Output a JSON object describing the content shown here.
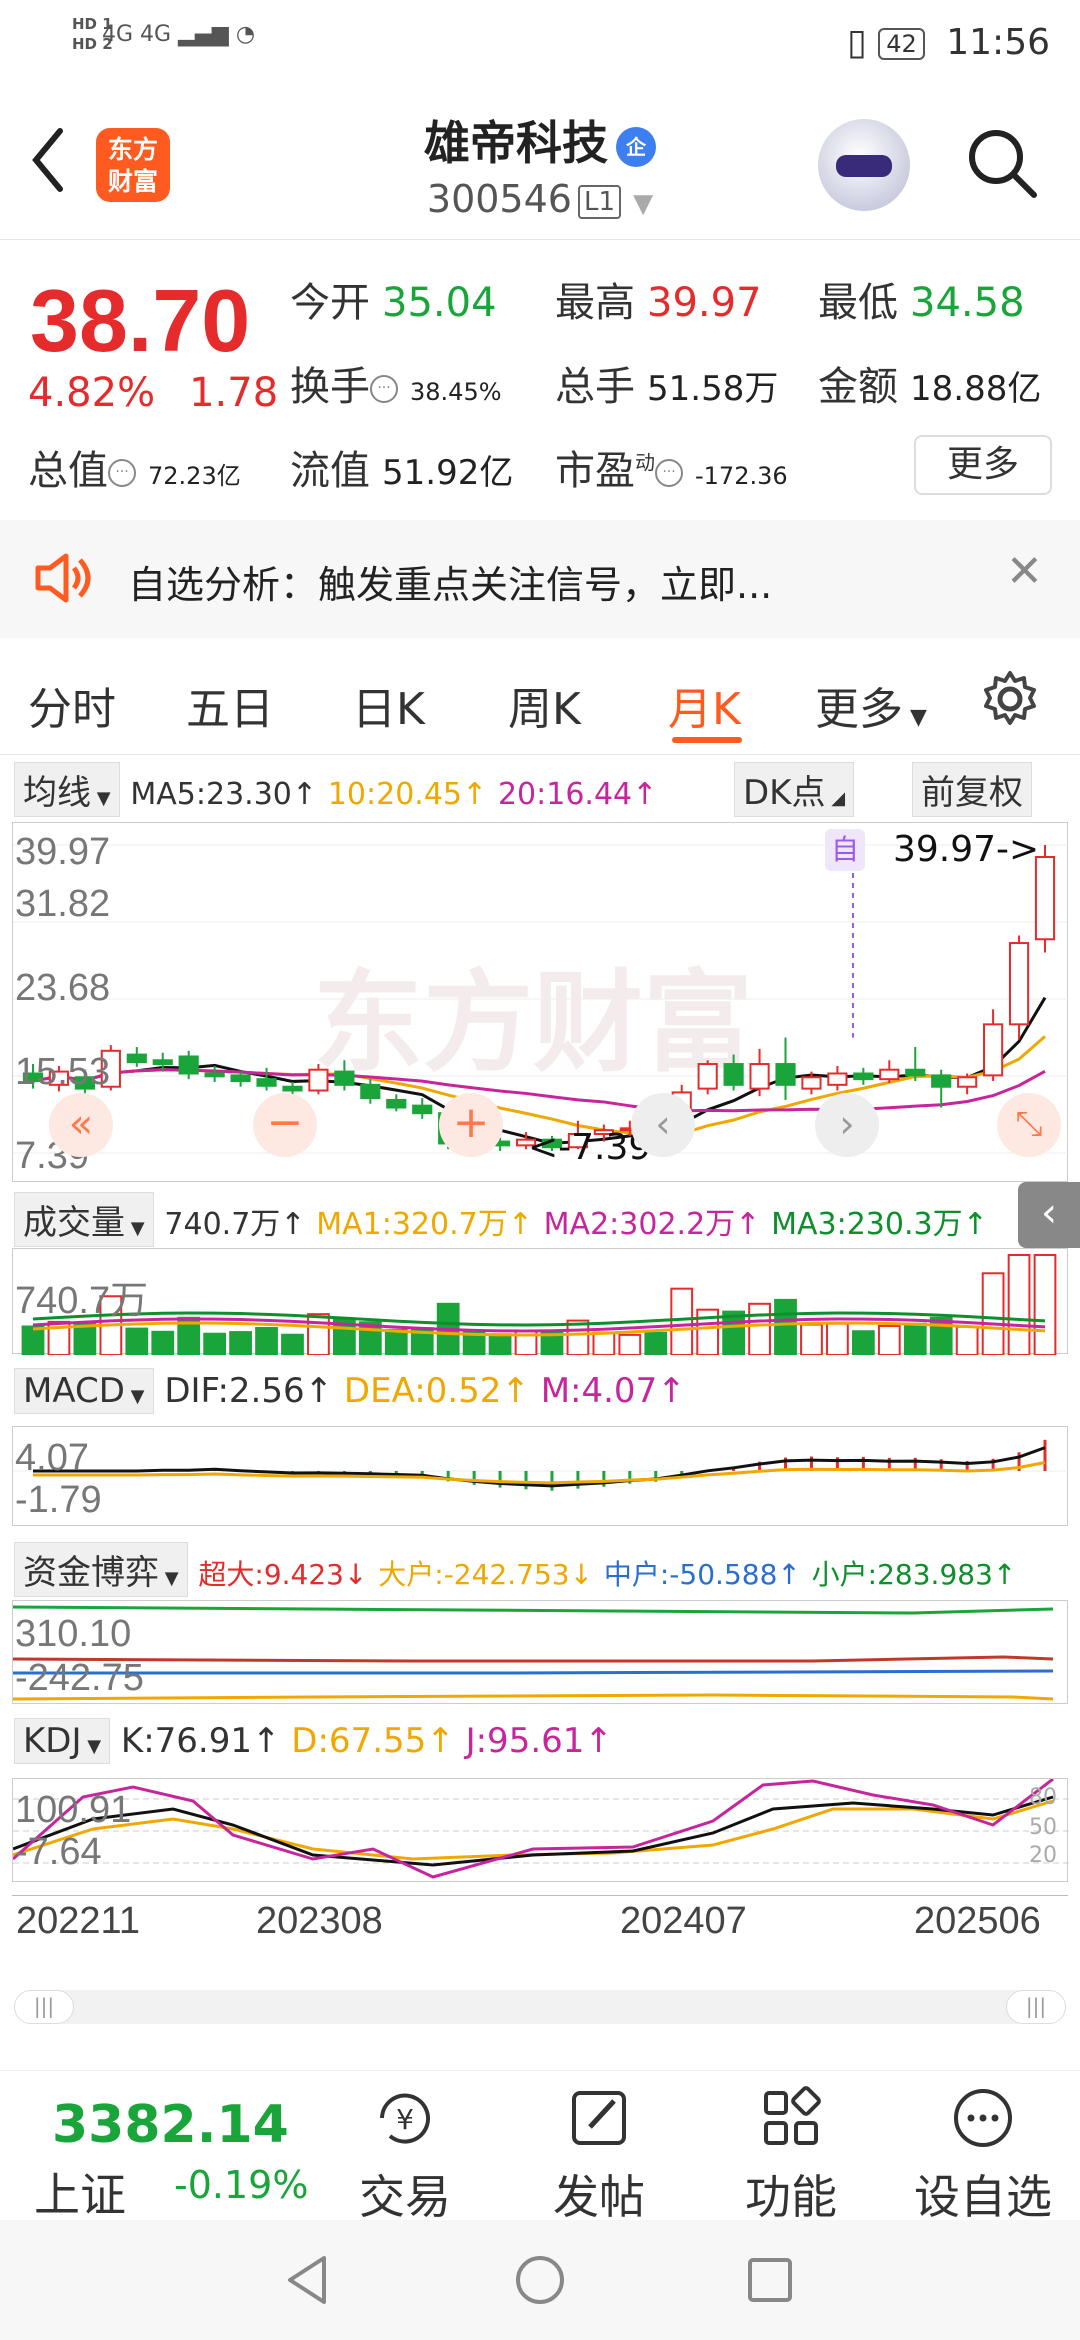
{
  "status": {
    "hd1": "HD 1",
    "hd2": "HD 2",
    "net": "4G 4G",
    "battery": "42",
    "time": "11:56"
  },
  "header": {
    "title": "雄帝科技",
    "badge": "企",
    "code": "300546",
    "level": "L1",
    "logo_line1": "东方",
    "logo_line2": "财富"
  },
  "quote": {
    "price": "38.70",
    "pct": "4.82%",
    "change": "1.78",
    "open_label": "今开",
    "open": "35.04",
    "high_label": "最高",
    "high": "39.97",
    "low_label": "最低",
    "low": "34.58",
    "turnover_label": "换手",
    "turnover": "38.45%",
    "volume_label": "总手",
    "volume": "51.58万",
    "amount_label": "金额",
    "amount": "18.88亿",
    "mktcap_label": "总值",
    "mktcap": "72.23亿",
    "float_label": "流值",
    "float": "51.92亿",
    "pe_label": "市盈",
    "pe_sup": "动",
    "pe": "-172.36",
    "more": "更多"
  },
  "notice": {
    "text": "自选分析：触发重点关注信号，立即..."
  },
  "tabs": [
    "分时",
    "五日",
    "日K",
    "周K",
    "月K",
    "更多"
  ],
  "active_tab": "月K",
  "kline": {
    "ma_select": "均线",
    "ma5": "MA5:23.30↑",
    "ma10": "10:20.45↑",
    "ma20": "20:16.44↑",
    "dk": "DK点",
    "adj": "前复权",
    "y_labels": [
      "39.97",
      "31.82",
      "23.68",
      "15.53",
      "7.39"
    ],
    "max_mark": "39.97->",
    "min_mark": "<-7.39",
    "self_tag": "自"
  },
  "volume": {
    "select": "成交量",
    "v": "740.7万↑",
    "ma1": "MA1:320.7万↑",
    "ma2": "MA2:302.2万↑",
    "ma3": "MA3:230.3万↑",
    "ylabel": "740.7万"
  },
  "macd": {
    "select": "MACD",
    "dif": "DIF:2.56↑",
    "dea": "DEA:0.52↑",
    "m": "M:4.07↑",
    "y1": "4.07",
    "y2": "-1.79"
  },
  "fund": {
    "select": "资金博弈",
    "super": "超大:9.423↓",
    "big": "大户:-242.753↓",
    "mid": "中户:-50.588↑",
    "small": "小户:283.983↑",
    "y1": "310.10",
    "y2": "-242.75"
  },
  "kdj": {
    "select": "KDJ",
    "k": "K:76.91↑",
    "d": "D:67.55↑",
    "j": "J:95.61↑",
    "y1": "100.91",
    "y2": "-7.64",
    "r1": "80",
    "r2": "50",
    "r3": "20"
  },
  "xaxis": [
    "202211",
    "202308",
    "202407",
    "202506"
  ],
  "index": {
    "value": "3382.14",
    "name": "上证",
    "pct": "-0.19%"
  },
  "nav": [
    "交易",
    "发帖",
    "功能",
    "设自选"
  ],
  "colors": {
    "up": "#e52b2b",
    "down": "#1aa53a",
    "accent": "#ff5a1f"
  },
  "chart_data": {
    "type": "candlestick",
    "ylim": [
      7.39,
      39.97
    ],
    "candles": [
      {
        "o": 15.8,
        "c": 15.0,
        "h": 16.8,
        "l": 14.2
      },
      {
        "o": 14.6,
        "c": 16.0,
        "h": 16.6,
        "l": 13.9
      },
      {
        "o": 15.4,
        "c": 14.2,
        "h": 16.2,
        "l": 13.6
      },
      {
        "o": 14.4,
        "c": 18.2,
        "h": 18.8,
        "l": 14.0
      },
      {
        "o": 17.8,
        "c": 17.0,
        "h": 18.6,
        "l": 16.5
      },
      {
        "o": 17.2,
        "c": 16.8,
        "h": 18.0,
        "l": 16.0
      },
      {
        "o": 17.6,
        "c": 15.8,
        "h": 18.2,
        "l": 15.2
      },
      {
        "o": 15.8,
        "c": 15.5,
        "h": 16.6,
        "l": 14.9
      },
      {
        "o": 15.6,
        "c": 15.0,
        "h": 16.0,
        "l": 14.4
      },
      {
        "o": 15.2,
        "c": 14.5,
        "h": 16.4,
        "l": 14.0
      },
      {
        "o": 14.4,
        "c": 14.0,
        "h": 14.9,
        "l": 13.6
      },
      {
        "o": 14.0,
        "c": 16.2,
        "h": 16.8,
        "l": 13.6
      },
      {
        "o": 16.0,
        "c": 14.6,
        "h": 17.2,
        "l": 14.0
      },
      {
        "o": 14.6,
        "c": 13.2,
        "h": 15.2,
        "l": 12.6
      },
      {
        "o": 13.0,
        "c": 12.2,
        "h": 13.6,
        "l": 11.8
      },
      {
        "o": 12.4,
        "c": 11.6,
        "h": 13.2,
        "l": 11.0
      },
      {
        "o": 11.6,
        "c": 8.4,
        "h": 11.8,
        "l": 7.8
      },
      {
        "o": 8.8,
        "c": 8.6,
        "h": 10.0,
        "l": 7.39
      },
      {
        "o": 8.6,
        "c": 8.2,
        "h": 9.0,
        "l": 7.6
      },
      {
        "o": 8.2,
        "c": 8.8,
        "h": 9.6,
        "l": 7.8
      },
      {
        "o": 8.8,
        "c": 8.0,
        "h": 9.2,
        "l": 7.6
      },
      {
        "o": 8.0,
        "c": 9.4,
        "h": 10.8,
        "l": 7.8
      },
      {
        "o": 9.4,
        "c": 9.8,
        "h": 10.4,
        "l": 8.6
      },
      {
        "o": 9.8,
        "c": 10.0,
        "h": 10.8,
        "l": 9.2
      },
      {
        "o": 10.0,
        "c": 9.4,
        "h": 10.4,
        "l": 9.0
      },
      {
        "o": 9.4,
        "c": 13.8,
        "h": 14.6,
        "l": 9.0
      },
      {
        "o": 14.2,
        "c": 16.8,
        "h": 17.2,
        "l": 13.6
      },
      {
        "o": 16.8,
        "c": 14.6,
        "h": 17.8,
        "l": 14.0
      },
      {
        "o": 14.2,
        "c": 16.8,
        "h": 18.4,
        "l": 13.4
      },
      {
        "o": 16.8,
        "c": 14.6,
        "h": 19.6,
        "l": 13.0
      },
      {
        "o": 14.2,
        "c": 15.4,
        "h": 16.0,
        "l": 13.6
      },
      {
        "o": 14.6,
        "c": 15.8,
        "h": 16.6,
        "l": 14.0
      },
      {
        "o": 15.8,
        "c": 15.2,
        "h": 16.4,
        "l": 14.6
      },
      {
        "o": 15.2,
        "c": 16.2,
        "h": 17.2,
        "l": 14.8
      },
      {
        "o": 16.2,
        "c": 15.6,
        "h": 18.6,
        "l": 15.0
      },
      {
        "o": 15.6,
        "c": 14.4,
        "h": 16.2,
        "l": 12.2
      },
      {
        "o": 14.4,
        "c": 15.4,
        "h": 15.8,
        "l": 13.6
      },
      {
        "o": 15.6,
        "c": 21.0,
        "h": 22.6,
        "l": 15.0
      },
      {
        "o": 21.0,
        "c": 29.6,
        "h": 30.4,
        "l": 19.4
      },
      {
        "o": 30.0,
        "c": 38.7,
        "h": 39.97,
        "l": 28.6
      }
    ]
  }
}
